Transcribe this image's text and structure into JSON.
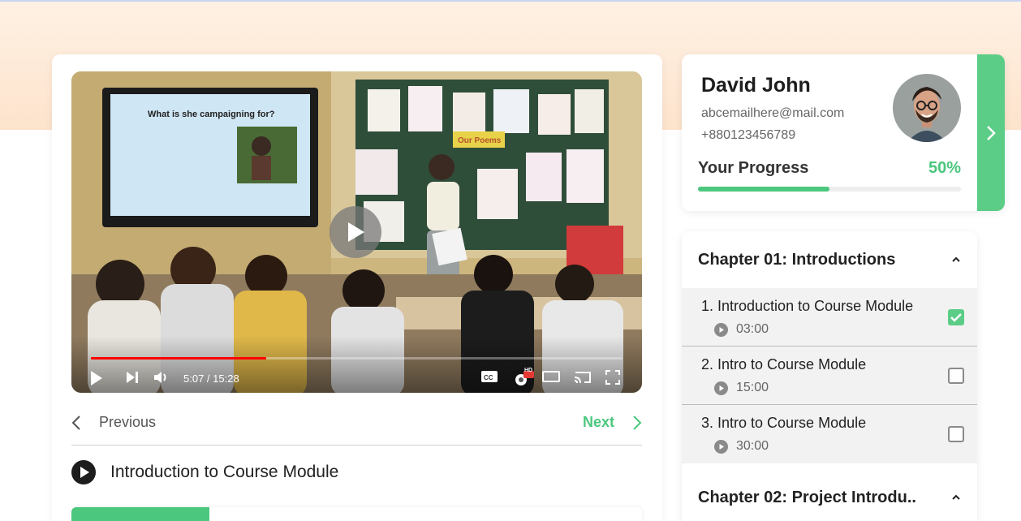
{
  "player": {
    "time_display": "5:07 / 15:28",
    "progress_fraction": 0.33,
    "slide_text": "What is she campaigning for?",
    "board_label": "Our Poems",
    "hd_badge": "HD",
    "accent": "#ff0000"
  },
  "nav": {
    "previous_label": "Previous",
    "next_label": "Next"
  },
  "current_lesson": {
    "title": "Introduction to Course Module"
  },
  "profile": {
    "name": "David John",
    "email": "abcemailhere@mail.com",
    "phone": "+880123456789",
    "progress_label": "Your Progress",
    "progress_value": "50%",
    "progress_fraction": 0.5
  },
  "chapters": [
    {
      "title": "Chapter 01: Introductions",
      "expanded": true,
      "lectures": [
        {
          "title": "1. Introduction to Course Module",
          "duration": "03:00",
          "completed": true
        },
        {
          "title": "2. Intro to Course Module",
          "duration": "15:00",
          "completed": false
        },
        {
          "title": "3. Intro to Course Module",
          "duration": "30:00",
          "completed": false
        }
      ]
    },
    {
      "title": "Chapter 02: Project Introdu..",
      "expanded": false,
      "lectures": []
    }
  ],
  "colors": {
    "accent_green": "#4cc77e",
    "header_peach": "#fde3cc"
  }
}
